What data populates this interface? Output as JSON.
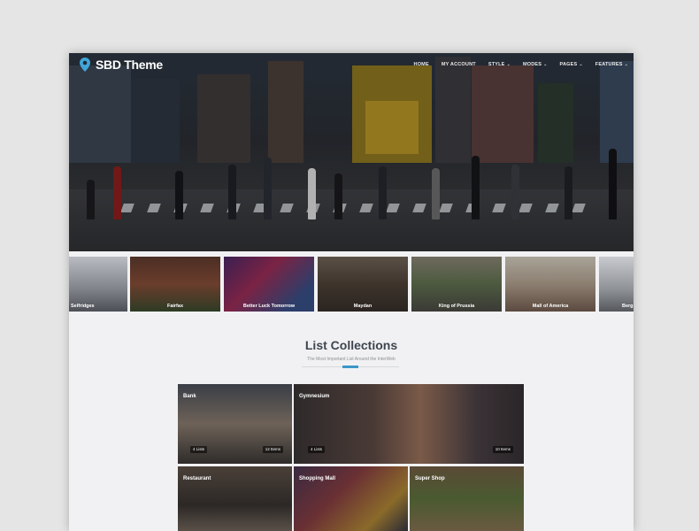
{
  "header": {
    "logo_text": "SBD Theme",
    "nav": [
      {
        "label": "HOME",
        "has_dropdown": false
      },
      {
        "label": "MY ACCOUNT",
        "has_dropdown": false
      },
      {
        "label": "STYLE",
        "has_dropdown": true
      },
      {
        "label": "MODES",
        "has_dropdown": true
      },
      {
        "label": "PAGES",
        "has_dropdown": true
      },
      {
        "label": "FEATURES",
        "has_dropdown": true
      }
    ]
  },
  "locations": [
    {
      "label": "Selfridges"
    },
    {
      "label": "Fairfax"
    },
    {
      "label": "Better Luck Tomorrow"
    },
    {
      "label": "Maydan"
    },
    {
      "label": "King of Prussia"
    },
    {
      "label": "Mall of America"
    },
    {
      "label": "Berg"
    }
  ],
  "collections": {
    "title": "List Collections",
    "subtitle": "The Most Important List Around the InterWeb",
    "items": [
      {
        "name": "Bank",
        "lists": "4 Lists",
        "items": "12 Items"
      },
      {
        "name": "Gymnesium",
        "lists": "4 Lists",
        "items": "10 Items"
      },
      {
        "name": "Restaurant"
      },
      {
        "name": "Shopping Mall"
      },
      {
        "name": "Super Shop"
      }
    ]
  },
  "colors": {
    "accent": "#3a97c9",
    "pin": "#41a6d9"
  }
}
